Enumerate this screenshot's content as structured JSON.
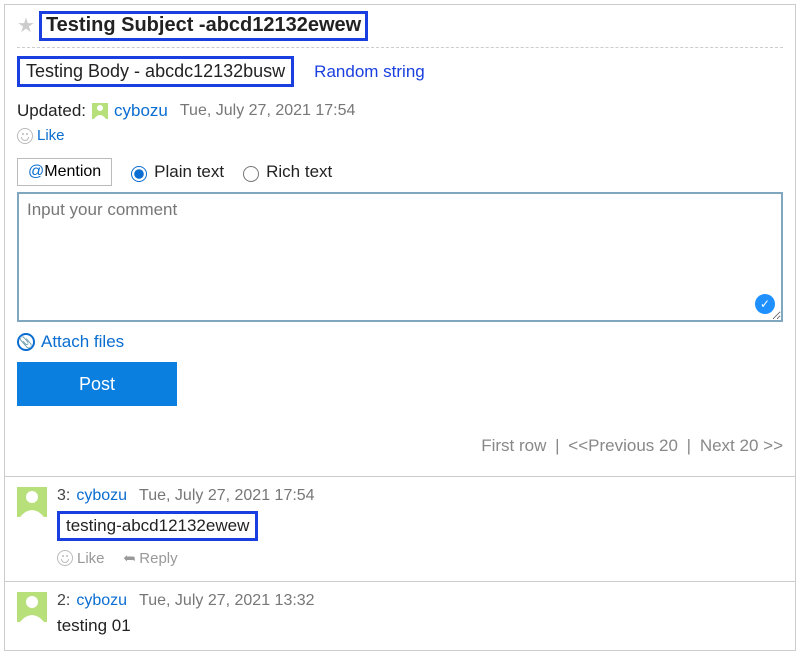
{
  "title": "Testing Subject -abcd12132ewew",
  "body": "Testing Body - abcdc12132busw",
  "random_label": "Random string",
  "updated_label": "Updated:",
  "updated_user": "cybozu",
  "updated_time": "Tue, July 27, 2021 17:54",
  "like_label": "Like",
  "mention_at": "@",
  "mention_label": "Mention",
  "format": {
    "plain": "Plain text",
    "rich": "Rich text"
  },
  "comment_placeholder": "Input your comment",
  "attach_label": "Attach files",
  "post_label": "Post",
  "pager": {
    "first": "First row",
    "prev": "<<Previous 20",
    "next": "Next 20 >>"
  },
  "comments": {
    "c0": {
      "num": "3:",
      "user": "cybozu",
      "time": "Tue, July 27, 2021 17:54",
      "body": "testing-abcd12132ewew",
      "boxed": true
    },
    "c1": {
      "num": "2:",
      "user": "cybozu",
      "time": "Tue, July 27, 2021 13:32",
      "body": "testing 01",
      "boxed": false
    }
  },
  "reply_label": "Reply"
}
